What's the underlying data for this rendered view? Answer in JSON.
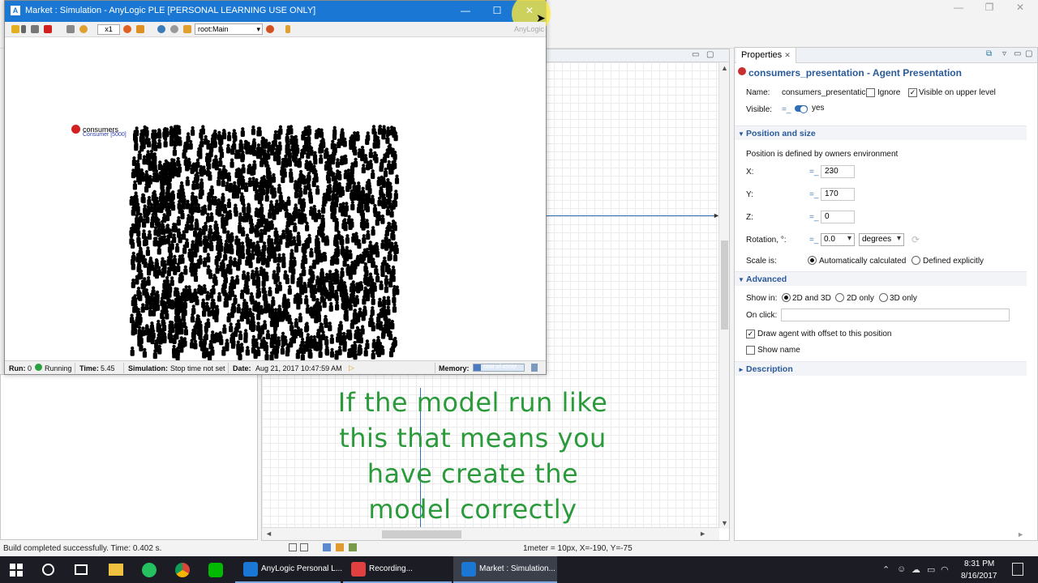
{
  "sim_window": {
    "title": "Market : Simulation - AnyLogic PLE [PERSONAL LEARNING USE ONLY]",
    "controls": [
      "—",
      "☐",
      "✕"
    ],
    "toolbar": {
      "speed": "x1",
      "root": "root:Main",
      "logo": "AnyLogic"
    },
    "canvas": {
      "agent_name": "consumers",
      "agent_count": "Consumer [5000]"
    },
    "status": {
      "run_label": "Run:",
      "run_value": "0",
      "state": "Running",
      "time_label": "Time:",
      "time_value": "5.45",
      "simulation_label": "Simulation:",
      "simulation_value": "Stop time not set",
      "date_label": "Date:",
      "date_value": "Aug 21, 2017 10:47:59 AM",
      "memory_label": "Memory:",
      "memory_value": "68M of 455M",
      "memory_fraction": 0.15
    }
  },
  "ide": {
    "controls": [
      "—",
      "❐",
      "✕"
    ],
    "status_text": "Build completed successfully. Time: 0.402 s.",
    "coords": "1meter = 10px, X=-190, Y=-75"
  },
  "properties": {
    "tab_label": "Properties",
    "title": "consumers_presentation - Agent Presentation",
    "name_label": "Name:",
    "name_value": "consumers_presentatic",
    "ignore_label": "Ignore",
    "visible_upper_label": "Visible on upper level",
    "visible_label": "Visible:",
    "visible_value": "yes",
    "position_section": "Position and size",
    "position_note": "Position is defined by owners environment",
    "x_label": "X:",
    "x_value": "230",
    "y_label": "Y:",
    "y_value": "170",
    "z_label": "Z:",
    "z_value": "0",
    "rotation_label": "Rotation, °:",
    "rotation_value": "0.0",
    "rotation_unit": "degrees",
    "scale_label": "Scale is:",
    "scale_auto": "Automatically calculated",
    "scale_explicit": "Defined explicitly",
    "advanced_section": "Advanced",
    "show_in_label": "Show in:",
    "show_2d3d": "2D and 3D",
    "show_2d": "2D only",
    "show_3d": "3D only",
    "onclick_label": "On click:",
    "onclick_value": "",
    "offset_label": "Draw agent with offset to this position",
    "showname_label": "Show name",
    "description_section": "Description"
  },
  "caption": {
    "lines": [
      "If the model run like",
      "this that means you",
      "have create the",
      "model correctly"
    ]
  },
  "taskbar": {
    "apps": [
      {
        "label": "AnyLogic Personal L..."
      },
      {
        "label": "Recording..."
      },
      {
        "label": "Market : Simulation..."
      }
    ],
    "time": "8:31 PM",
    "date": "8/16/2017"
  },
  "colors": {
    "titlebar": "#1a78d4",
    "caption": "#2a9a3a",
    "section": "#2a5a9a",
    "taskbar": "#1c1c24"
  }
}
